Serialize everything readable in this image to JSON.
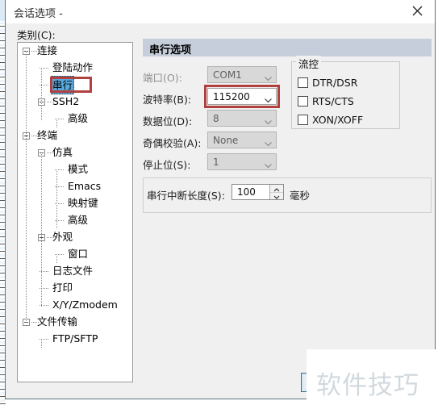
{
  "window": {
    "title": "会话选项 -",
    "close_icon": "close-icon"
  },
  "sidebar": {
    "label": "类别(C):",
    "items": [
      {
        "label": "连接",
        "level": 0,
        "expander": true,
        "selected": false
      },
      {
        "label": "登陆动作",
        "level": 1,
        "expander": false,
        "selected": false
      },
      {
        "label": "串行",
        "level": 1,
        "expander": false,
        "selected": true
      },
      {
        "label": "SSH2",
        "level": 1,
        "expander": true,
        "selected": false
      },
      {
        "label": "高级",
        "level": 2,
        "expander": false,
        "selected": false
      },
      {
        "label": "终端",
        "level": 0,
        "expander": true,
        "selected": false
      },
      {
        "label": "仿真",
        "level": 1,
        "expander": true,
        "selected": false
      },
      {
        "label": "模式",
        "level": 2,
        "expander": false,
        "selected": false
      },
      {
        "label": "Emacs",
        "level": 2,
        "expander": false,
        "selected": false
      },
      {
        "label": "映射键",
        "level": 2,
        "expander": false,
        "selected": false
      },
      {
        "label": "高级",
        "level": 2,
        "expander": false,
        "selected": false
      },
      {
        "label": "外观",
        "level": 1,
        "expander": true,
        "selected": false
      },
      {
        "label": "窗口",
        "level": 2,
        "expander": false,
        "selected": false
      },
      {
        "label": "日志文件",
        "level": 1,
        "expander": false,
        "selected": false
      },
      {
        "label": "打印",
        "level": 1,
        "expander": false,
        "selected": false
      },
      {
        "label": "X/Y/Zmodem",
        "level": 1,
        "expander": false,
        "selected": false
      },
      {
        "label": "文件传输",
        "level": 0,
        "expander": true,
        "selected": false
      },
      {
        "label": "FTP/SFTP",
        "level": 1,
        "expander": false,
        "selected": false
      }
    ]
  },
  "pane": {
    "header": "串行选项",
    "fields": {
      "port": {
        "label": "端口(O):",
        "value": "COM1",
        "disabled": true
      },
      "baud": {
        "label": "波特率(B):",
        "value": "115200",
        "disabled": false,
        "highlight_color": "#b0413e"
      },
      "databits": {
        "label": "数据位(D):",
        "value": "8",
        "disabled": true
      },
      "parity": {
        "label": "奇偶校验(A):",
        "value": "None",
        "disabled": true
      },
      "stopbits": {
        "label": "停止位(S):",
        "value": "1",
        "disabled": true
      }
    },
    "flow_control": {
      "legend": "流控",
      "checkboxes": [
        {
          "label": "DTR/DSR",
          "checked": false
        },
        {
          "label": "RTS/CTS",
          "checked": false
        },
        {
          "label": "XON/XOFF",
          "checked": false
        }
      ]
    },
    "break_length": {
      "label": "串行中断长度(S):",
      "value": "100",
      "unit": "毫秒"
    }
  },
  "footer": {
    "button_label": ""
  },
  "watermark": {
    "text": "软件技巧"
  }
}
